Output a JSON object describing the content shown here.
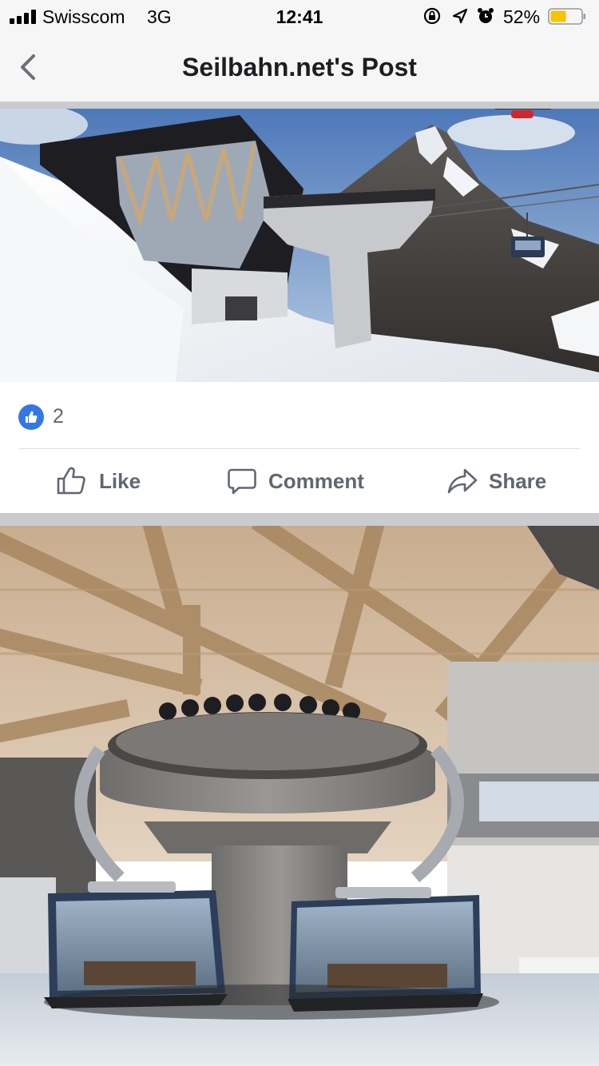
{
  "status_bar": {
    "carrier": "Swisscom",
    "network": "3G",
    "time": "12:41",
    "battery_percent": "52%",
    "battery_level": 0.52,
    "icons": [
      "signal-icon",
      "orientation-lock-icon",
      "location-icon",
      "alarm-icon",
      "battery-icon"
    ]
  },
  "nav": {
    "title": "Seilbahn.net's Post",
    "back_icon": "chevron-left-icon"
  },
  "post": {
    "reactions": {
      "icon": "like-reaction-icon",
      "count": "2"
    },
    "actions": {
      "like": {
        "label": "Like",
        "icon": "thumbs-up-icon"
      },
      "comment": {
        "label": "Comment",
        "icon": "comment-bubble-icon"
      },
      "share": {
        "label": "Share",
        "icon": "share-arrow-icon"
      }
    }
  },
  "colors": {
    "facebook_blue": "#3578e5",
    "action_gray": "#606770",
    "battery_yellow": "#f5c400"
  }
}
